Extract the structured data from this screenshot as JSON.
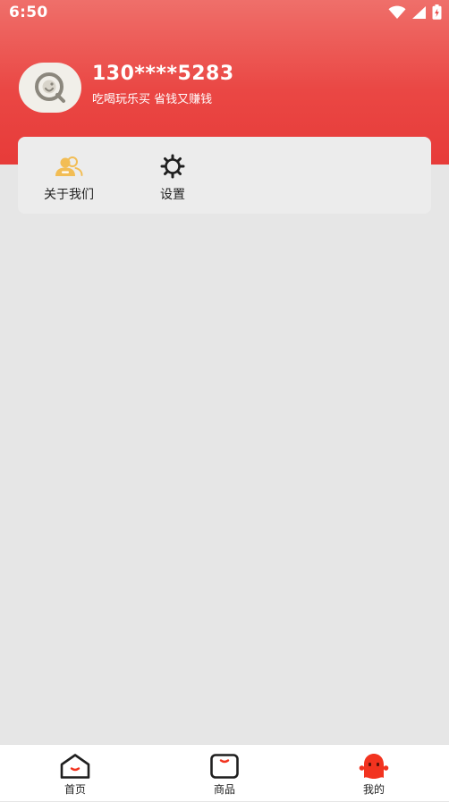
{
  "status_bar": {
    "time": "6:50",
    "icons": [
      "wifi-icon",
      "signal-icon",
      "battery-icon"
    ]
  },
  "profile": {
    "phone": "130****5283",
    "slogan": "吃喝玩乐买 省钱又赚钱",
    "avatar_icon": "avatar-logo-icon"
  },
  "menu": {
    "items": [
      {
        "label": "关于我们",
        "icon": "users-icon"
      },
      {
        "label": "设置",
        "icon": "gear-icon"
      }
    ]
  },
  "tabbar": {
    "items": [
      {
        "label": "首页",
        "icon": "home-icon"
      },
      {
        "label": "商品",
        "icon": "goods-icon"
      },
      {
        "label": "我的",
        "icon": "profile-icon",
        "active": true
      }
    ]
  },
  "colors": {
    "header_red": "#e84543",
    "accent_red": "#f2331f",
    "background": "#e6e6e6",
    "card": "#ececec",
    "icon_gold": "#f2bd55"
  }
}
